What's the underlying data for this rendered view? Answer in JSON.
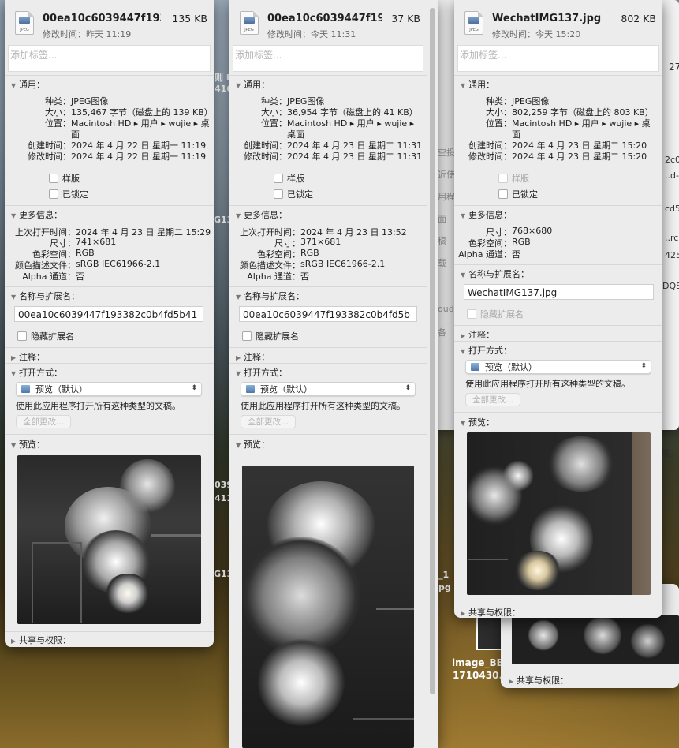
{
  "windows": [
    {
      "file_name": "00ea10c6039447f193...",
      "file_size": "135 KB",
      "modified_short": "修改时间：昨天 11:19",
      "tags_placeholder": "添加标签...",
      "general": {
        "header": "通用：",
        "rows": [
          {
            "label": "种类：",
            "value": "JPEG图像"
          },
          {
            "label": "大小：",
            "value": "135,467 字节（磁盘上的 139 KB）"
          },
          {
            "label": "位置：",
            "value": "Macintosh HD ▸ 用户 ▸ wujie ▸ 桌"
          },
          {
            "label": "",
            "value": "面"
          },
          {
            "label": "创建时间：",
            "value": "2024 年 4 月 22 日 星期一 11:19"
          },
          {
            "label": "修改时间：",
            "value": "2024 年 4 月 22 日 星期一 11:19"
          }
        ],
        "stationery": "样版",
        "locked": "已锁定"
      },
      "more": {
        "header": "更多信息：",
        "rows": [
          {
            "label": "上次打开时间：",
            "value": "2024 年 4 月 23 日 星期二 15:29"
          },
          {
            "label": "尺寸：",
            "value": "741×681"
          },
          {
            "label": "色彩空间：",
            "value": "RGB"
          },
          {
            "label": "颜色描述文件：",
            "value": "sRGB IEC61966-2.1"
          },
          {
            "label": "Alpha 通道：",
            "value": "否"
          }
        ]
      },
      "name_ext": {
        "header": "名称与扩展名：",
        "value": "00ea10c6039447f193382c0b4fd5b41",
        "hide_ext": "隐藏扩展名"
      },
      "comments": "注释：",
      "open_with": {
        "header": "打开方式：",
        "app": "预览（默认）",
        "help": "使用此应用程序打开所有这种类型的文稿。",
        "change_all": "全部更改..."
      },
      "preview_header": "预览：",
      "share": "共享与权限："
    },
    {
      "file_name": "00ea10c6039447f19...",
      "file_size": "37 KB",
      "modified_short": "修改时间：今天 11:31",
      "tags_placeholder": "添加标签...",
      "general": {
        "header": "通用：",
        "rows": [
          {
            "label": "种类：",
            "value": "JPEG图像"
          },
          {
            "label": "大小：",
            "value": "36,954 字节（磁盘上的 41 KB）"
          },
          {
            "label": "位置：",
            "value": "Macintosh HD ▸ 用户 ▸ wujie ▸"
          },
          {
            "label": "",
            "value": "桌面"
          },
          {
            "label": "创建时间：",
            "value": "2024 年 4 月 23 日 星期二 11:31"
          },
          {
            "label": "修改时间：",
            "value": "2024 年 4 月 23 日 星期二 11:31"
          }
        ],
        "stationery": "样版",
        "locked": "已锁定"
      },
      "more": {
        "header": "更多信息：",
        "rows": [
          {
            "label": "上次打开时间：",
            "value": "2024 年 4 月 23 日 13:52"
          },
          {
            "label": "尺寸：",
            "value": "371×681"
          },
          {
            "label": "色彩空间：",
            "value": "RGB"
          },
          {
            "label": "颜色描述文件：",
            "value": "sRGB IEC61966-2.1"
          },
          {
            "label": "Alpha 通道：",
            "value": "否"
          }
        ]
      },
      "name_ext": {
        "header": "名称与扩展名：",
        "value": "00ea10c6039447f193382c0b4fd5b",
        "hide_ext": "隐藏扩展名"
      },
      "comments": "注释：",
      "open_with": {
        "header": "打开方式：",
        "app": "预览（默认）",
        "help": "使用此应用程序打开所有这种类型的文稿。",
        "change_all": "全部更改..."
      },
      "preview_header": "预览："
    },
    {
      "file_name": "WechatIMG137.jpg",
      "file_size": "802 KB",
      "modified_short": "修改时间：今天 15:20",
      "tags_placeholder": "添加标签...",
      "general": {
        "header": "通用：",
        "rows": [
          {
            "label": "种类：",
            "value": "JPEG图像"
          },
          {
            "label": "大小：",
            "value": "802,259 字节（磁盘上的 803 KB）"
          },
          {
            "label": "位置：",
            "value": "Macintosh HD ▸ 用户 ▸ wujie ▸ 桌"
          },
          {
            "label": "",
            "value": "面"
          },
          {
            "label": "创建时间：",
            "value": "2024 年 4 月 23 日 星期二 15:20"
          },
          {
            "label": "修改时间：",
            "value": "2024 年 4 月 23 日 星期二 15:20"
          }
        ],
        "stationery": "样版",
        "locked": "已锁定"
      },
      "more": {
        "header": "更多信息：",
        "rows": [
          {
            "label": "尺寸：",
            "value": "768×680"
          },
          {
            "label": "色彩空间：",
            "value": "RGB"
          },
          {
            "label": "Alpha 通道：",
            "value": "否"
          }
        ]
      },
      "name_ext": {
        "header": "名称与扩展名：",
        "value": "WechatIMG137.jpg",
        "hide_ext": "隐藏扩展名"
      },
      "comments": "注释：",
      "open_with": {
        "header": "打开方式：",
        "app": "预览（默认）",
        "help": "使用此应用程序打开所有这种类型的文稿。",
        "change_all": "全部更改..."
      },
      "preview_header": "预览：",
      "share": "共享与权限："
    }
  ],
  "back_window": {
    "share": "共享与权限："
  },
  "background_texts": {
    "desktop_label_1": "image_BB",
    "desktop_label_2": "1710430...",
    "edge_1": "27",
    "edge_2": "2c0",
    "edge_3": "..d-",
    "edge_4": "cd5",
    "edge_5": "..rc",
    "edge_6": "425",
    "edge_7": "DQS",
    "edge_8": "稿。",
    "left_1": "空投",
    "left_2": "近使",
    "left_3": "用程",
    "left_4": "面",
    "left_5": "稿",
    "left_6": "载",
    "left_7": "oud",
    "left_8": "各",
    "mid_1": "_1",
    "mid_2": "pg",
    "dl_1": "G13",
    "dl_2": "039",
    "dl_3": "411",
    "dl_4": "G13",
    "dl_5": "则 P",
    "dl_6": "416"
  }
}
